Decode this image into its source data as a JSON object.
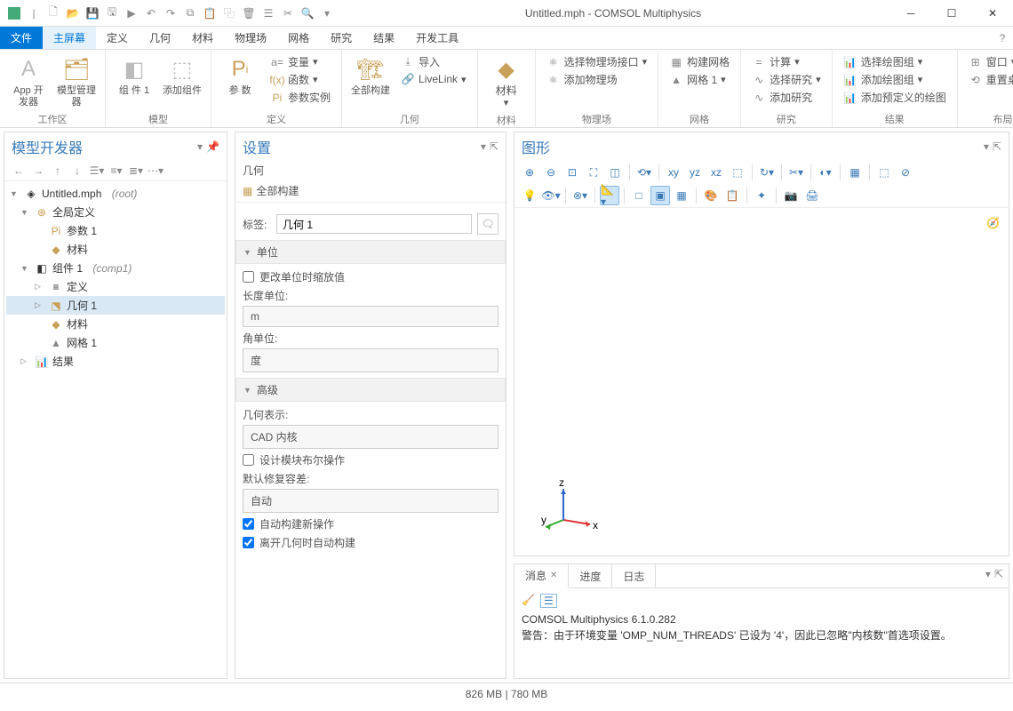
{
  "window": {
    "title": "Untitled.mph - COMSOL Multiphysics"
  },
  "tabs": {
    "file": "文件",
    "home": "主屏幕",
    "def": "定义",
    "geom": "几何",
    "mat": "材料",
    "phys": "物理场",
    "mesh": "网格",
    "study": "研究",
    "res": "结果",
    "dev": "开发工具"
  },
  "ribbon": {
    "appbuilder": "App\n开发器",
    "modelmgr": "模型管理器",
    "group_ws": "工作区",
    "component": "组\n件 1",
    "addcomp": "添加组件",
    "group_model": "模型",
    "params": "参\n数",
    "var": "变量",
    "func": "函数",
    "paramcase": "参数实例",
    "pi": "Pi",
    "group_def": "定义",
    "buildall": "全部构建",
    "import": "导入",
    "livelink": "LiveLink",
    "group_geom": "几何",
    "material": "材料",
    "group_mat": "材料",
    "phys_sel": "选择物理场接口",
    "phys_add": "添加物理场",
    "group_phys": "物理场",
    "mesh_build": "构建网格",
    "mesh_1": "网格 1",
    "group_mesh": "网格",
    "compute": "计算",
    "study_sel": "选择研究",
    "study_add": "添加研究",
    "group_study": "研究",
    "plotgrp_sel": "选择绘图组",
    "plotgrp_add": "添加绘图组",
    "plotgrp_pre": "添加预定义的绘图",
    "group_res": "结果",
    "window": "窗口",
    "resetdesk": "重置桌面",
    "group_layout": "布局"
  },
  "model_builder": {
    "title": "模型开发器",
    "root": "Untitled.mph",
    "root_suffix": "(root)",
    "global": "全局定义",
    "params1": "参数 1",
    "mat": "材料",
    "comp1": "组件 1",
    "comp1_suffix": "(comp1)",
    "def": "定义",
    "geom1": "几何 1",
    "mat2": "材料",
    "mesh1": "网格 1",
    "results": "结果"
  },
  "settings": {
    "title": "设置",
    "subtitle": "几何",
    "buildall": "全部构建",
    "label_lbl": "标签:",
    "label_val": "几何 1",
    "sec_units": "单位",
    "scale_on_unit": "更改单位时缩放值",
    "length_lbl": "长度单位:",
    "length_val": "m",
    "angle_lbl": "角单位:",
    "angle_val": "度",
    "sec_adv": "高级",
    "geomrep_lbl": "几何表示:",
    "geomrep_val": "CAD 内核",
    "design_bool": "设计模块布尔操作",
    "repair_lbl": "默认修复容差:",
    "repair_val": "自动",
    "auto_build_new": "自动构建新操作",
    "auto_build_leave": "离开几何时自动构建"
  },
  "graphics": {
    "title": "图形",
    "axes": {
      "x": "x",
      "y": "y",
      "z": "z"
    }
  },
  "messages": {
    "tab_msg": "消息",
    "tab_prog": "进度",
    "tab_log": "日志",
    "line1": "COMSOL Multiphysics 6.1.0.282",
    "line2": "警告：由于环境变量 'OMP_NUM_THREADS' 已设为 '4'，因此已忽略\"内核数\"首选项设置。"
  },
  "status": {
    "mem": "826 MB | 780 MB"
  }
}
